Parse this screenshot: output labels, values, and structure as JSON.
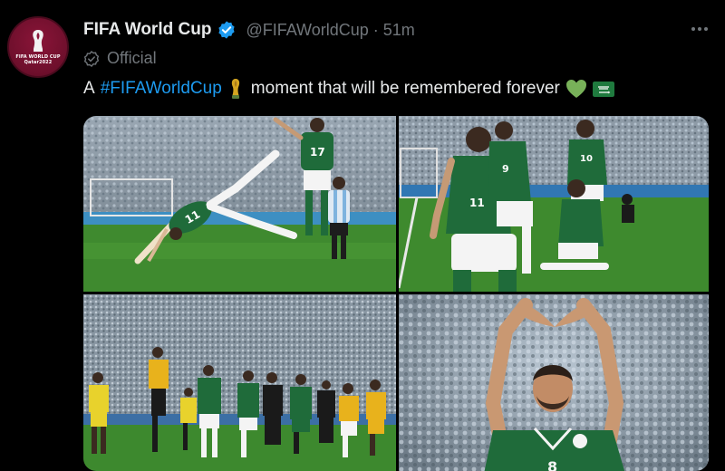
{
  "account": {
    "display_name": "FIFA World Cup",
    "handle": "@FIFAWorldCup",
    "separator": "·",
    "time": "51m",
    "label": "Official",
    "avatar_text_line1": "FIFA WORLD CUP",
    "avatar_text_line2": "Qatar2022"
  },
  "tweet": {
    "prefix": "A",
    "hashtag": "#FIFAWorldCup",
    "body": "moment that will be remembered forever"
  },
  "icons": {
    "verified": "verified-badge-icon",
    "official": "official-label-icon",
    "more": "more-options-icon",
    "trophy": "trophy-emoji-icon",
    "heart": "green-heart-icon",
    "flag": "saudi-flag-icon"
  },
  "colors": {
    "background": "#000000",
    "accent": "#1d9bf0",
    "muted": "#71767b",
    "text": "#e7e9ea",
    "avatar": "#8a1538",
    "saudi_green": "#1f6b3a"
  },
  "media": [
    {
      "name": "photo-player-cartwheel",
      "jersey": "11",
      "jersey2": "17"
    },
    {
      "name": "photo-players-celebrating",
      "jersey": "11",
      "jersey2": "9"
    },
    {
      "name": "photo-team-on-pitch"
    },
    {
      "name": "photo-heart-hands",
      "jersey": "8"
    }
  ]
}
